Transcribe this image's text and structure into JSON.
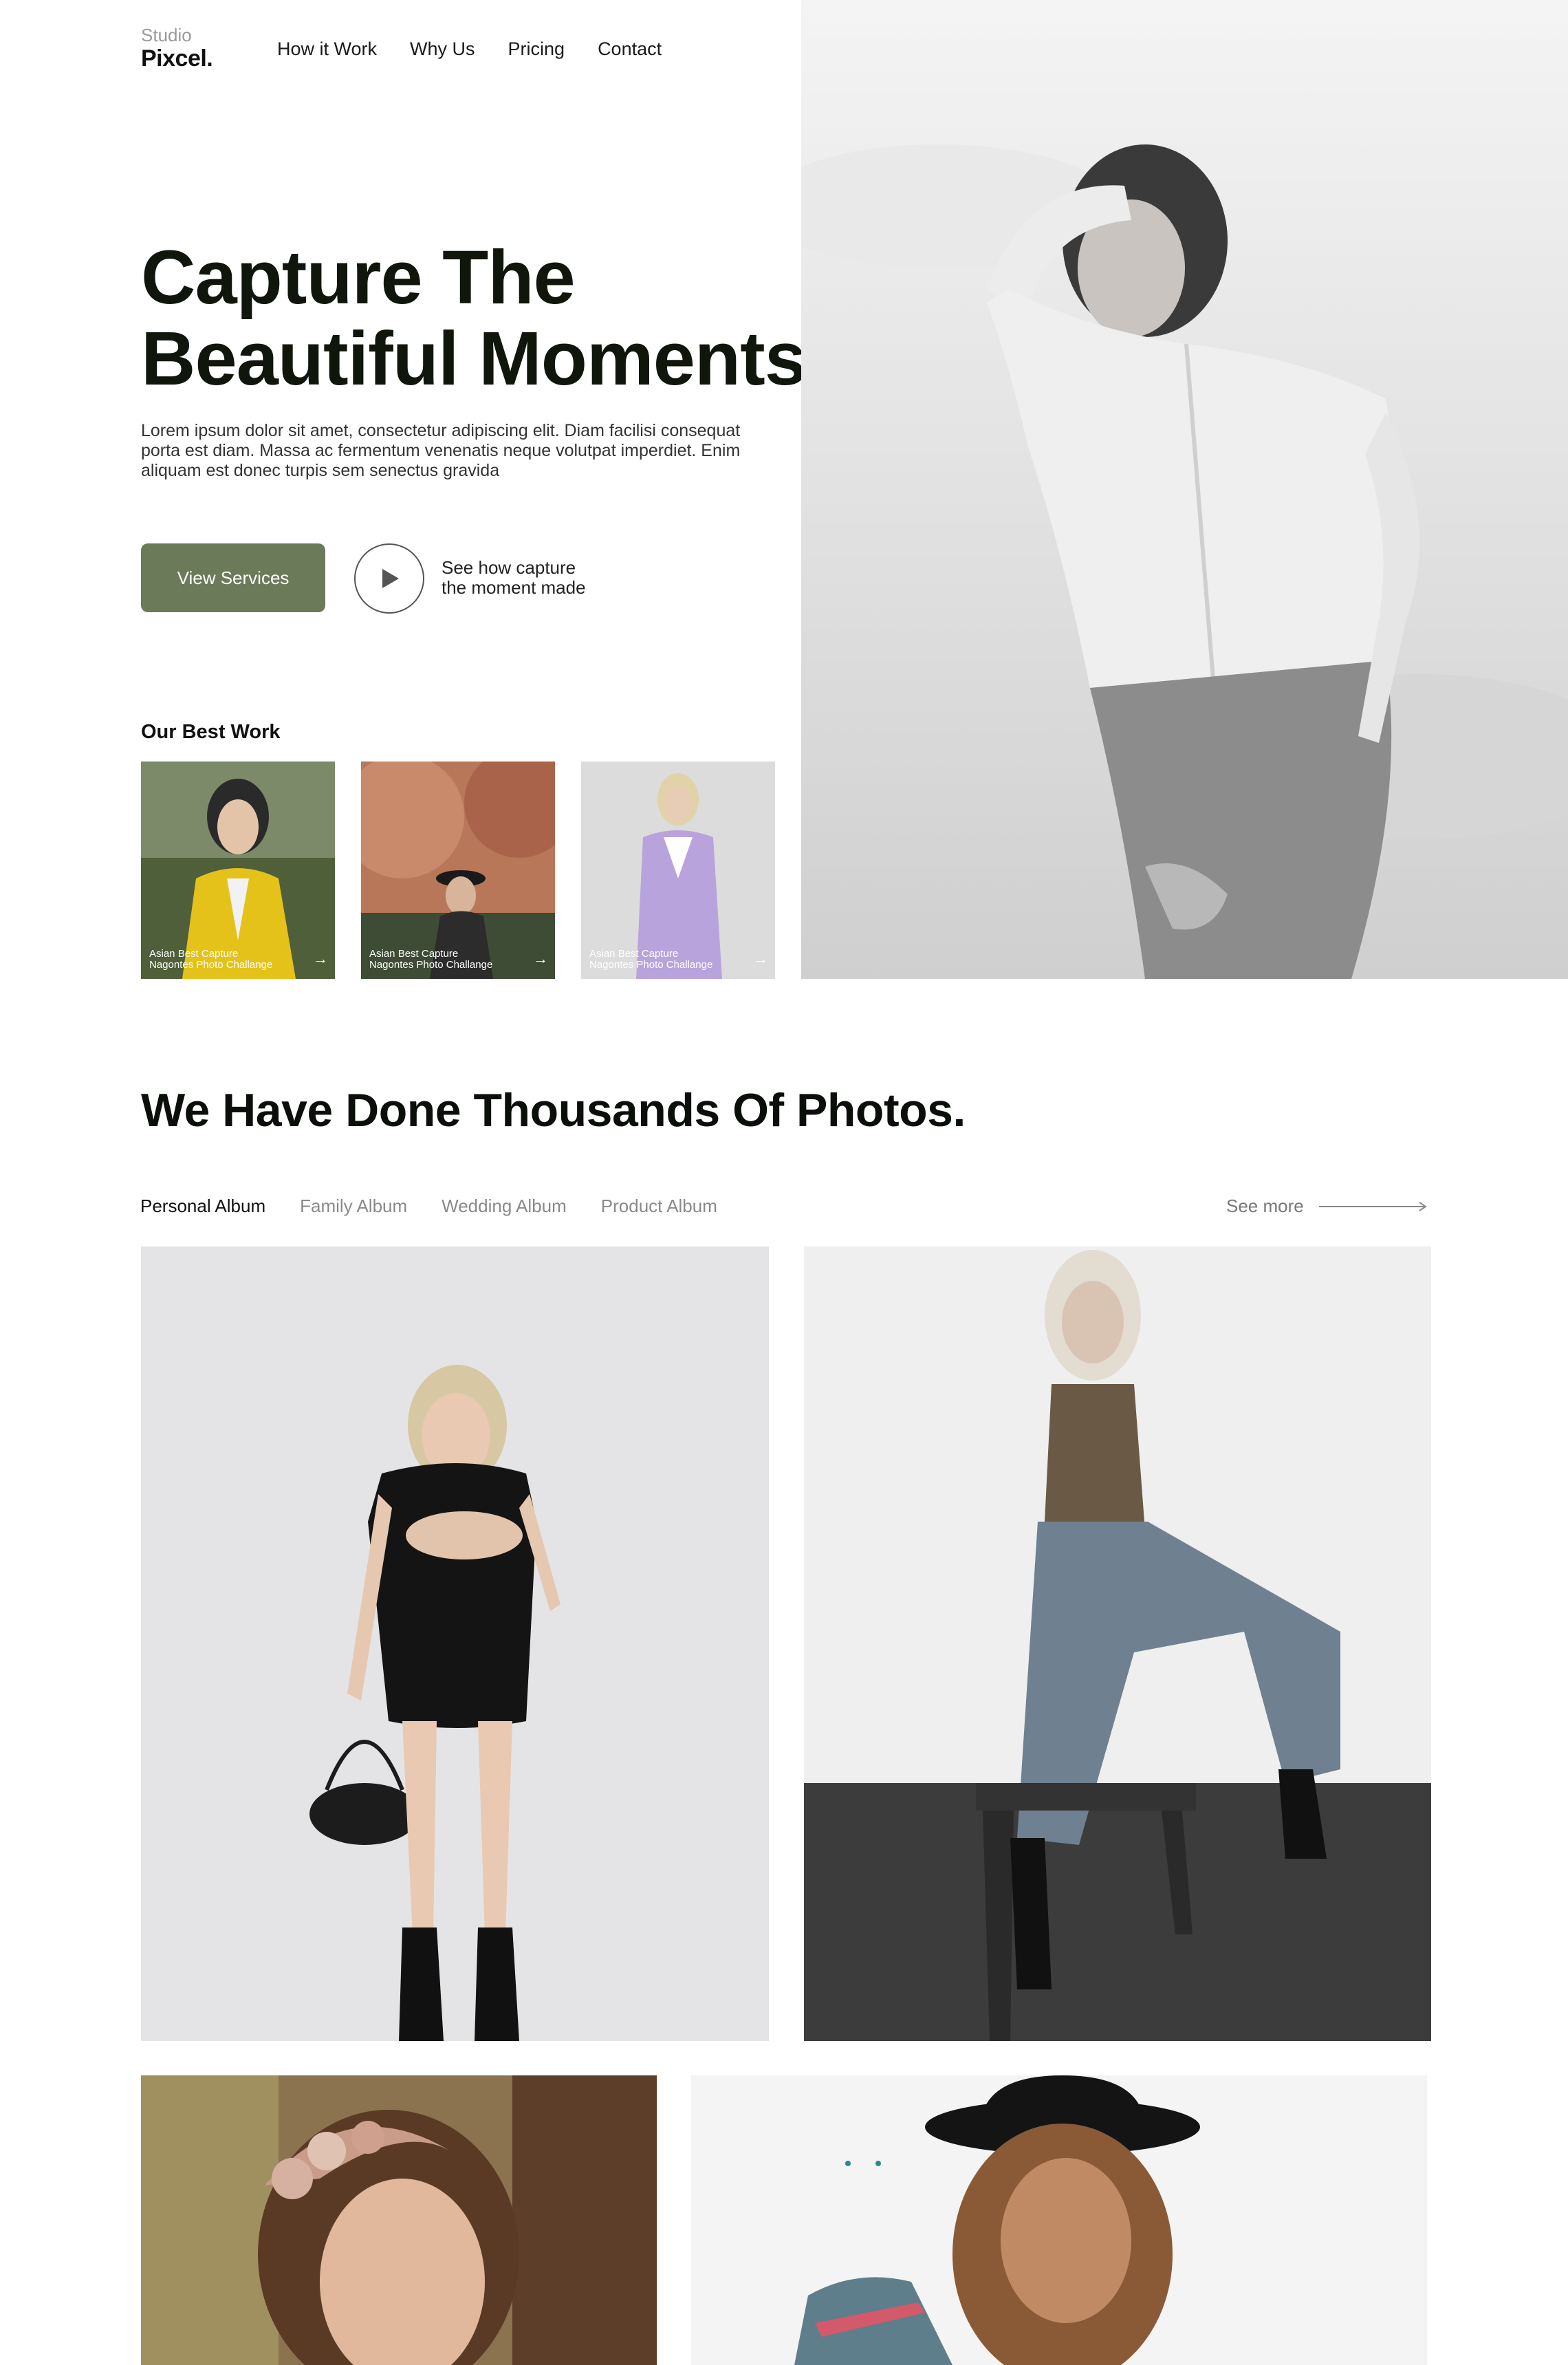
{
  "header": {
    "logo_small": "Studio",
    "logo_main": "Pixcel.",
    "nav": [
      "How it Work",
      "Why Us",
      "Pricing",
      "Contact"
    ]
  },
  "hero": {
    "title_line1": "Capture The",
    "title_line2": "Beautiful Moments.",
    "description": "Lorem ipsum dolor sit amet, consectetur adipiscing elit. Diam facilisi consequat porta est diam. Massa ac fermentum venenatis neque volutpat imperdiet. Enim aliquam est donec turpis sem senectus gravida",
    "cta_label": "View Services",
    "play_text_line1": "See how capture",
    "play_text_line2": "the moment made"
  },
  "best_work": {
    "title": "Our Best Work",
    "items": [
      {
        "caption_line1": "Asian Best Capture",
        "caption_line2": "Nagontes Photo Challange"
      },
      {
        "caption_line1": "Asian Best Capture",
        "caption_line2": "Nagontes Photo Challange"
      },
      {
        "caption_line1": "Asian Best Capture",
        "caption_line2": "Nagontes Photo Challange"
      }
    ]
  },
  "gallery": {
    "title": "We Have Done Thousands Of Photos.",
    "tabs": [
      "Personal Album",
      "Family Album",
      "Wedding Album",
      "Product Album"
    ],
    "active_tab": "Personal Album",
    "see_more": "See more"
  },
  "colors": {
    "accent_green": "#6b7a58",
    "heading": "#10160b",
    "muted": "#8a8a8a"
  }
}
